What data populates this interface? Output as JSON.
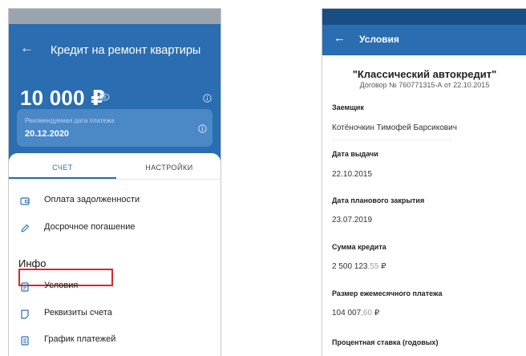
{
  "left_screen": {
    "back_icon": "arrow-left-icon",
    "title": "Кредит на ремонт квартиры",
    "amount": "10 000 ₽",
    "payment_card": {
      "label": "Рекомендуемая дата платежа",
      "date": "20.12.2020"
    },
    "tabs": [
      {
        "label": "СЧЕТ",
        "active": true
      },
      {
        "label": "НАСТРОЙКИ",
        "active": false
      }
    ],
    "actions": [
      {
        "label": "Оплата задолженности",
        "icon": "wallet-icon"
      },
      {
        "label": "Досрочное погашение",
        "icon": "pencil-icon"
      }
    ],
    "info_section_title": "Инфо",
    "info_items": [
      {
        "label": "Условия",
        "icon": "document-icon",
        "highlighted": true
      },
      {
        "label": "Реквизиты счета",
        "icon": "document-icon"
      },
      {
        "label": "График платежей",
        "icon": "document-icon"
      }
    ],
    "colors": {
      "primary": "#2a6db0",
      "highlight": "#d9262e"
    }
  },
  "right_screen": {
    "back_icon": "arrow-left-icon",
    "title": "Условия",
    "product_name": "\"Классический автокредит\"",
    "contract": "Договор № 760771315-А от 22.10.2015",
    "fields": [
      {
        "label": "Заемщик",
        "value": "Котёночкин Тимофей Барсикович"
      },
      {
        "label": "Дата выдачи",
        "value": "22.10.2015"
      },
      {
        "label": "Дата планового закрытия",
        "value": "23.07.2019"
      },
      {
        "label": "Сумма кредита",
        "value_main": "2 500 123",
        "value_kop": ",55",
        "currency": " ₽"
      },
      {
        "label": "Размер ежемесячного платежа",
        "value_main": "104 007",
        "value_kop": ",60",
        "currency": " ₽"
      },
      {
        "label": "Процентная ставка (годовых)"
      }
    ]
  }
}
